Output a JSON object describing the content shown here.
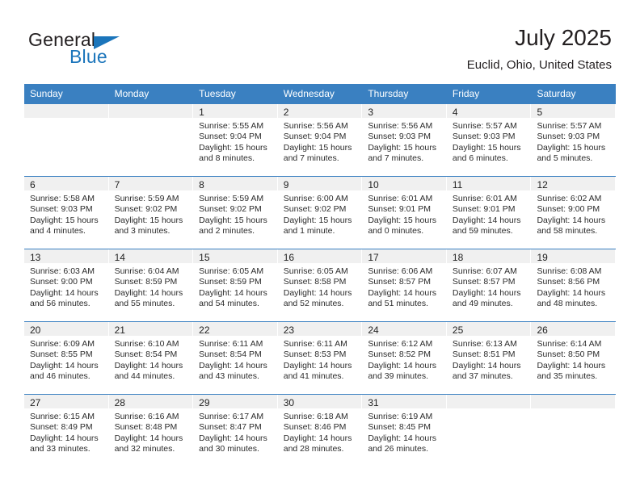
{
  "brand": {
    "name_part1": "General",
    "name_part2": "Blue",
    "triangle_icon": "triangle-icon",
    "accent_color": "#1b75bb"
  },
  "header": {
    "title": "July 2025",
    "location": "Euclid, Ohio, United States"
  },
  "calendar": {
    "header_bg": "#3a80c1",
    "day_band_bg": "#f0f0f0",
    "weekdays": [
      "Sunday",
      "Monday",
      "Tuesday",
      "Wednesday",
      "Thursday",
      "Friday",
      "Saturday"
    ],
    "weeks": [
      [
        {
          "blank": true
        },
        {
          "blank": true
        },
        {
          "day": "1",
          "sunrise": "Sunrise: 5:55 AM",
          "sunset": "Sunset: 9:04 PM",
          "daylight": "Daylight: 15 hours and 8 minutes."
        },
        {
          "day": "2",
          "sunrise": "Sunrise: 5:56 AM",
          "sunset": "Sunset: 9:04 PM",
          "daylight": "Daylight: 15 hours and 7 minutes."
        },
        {
          "day": "3",
          "sunrise": "Sunrise: 5:56 AM",
          "sunset": "Sunset: 9:03 PM",
          "daylight": "Daylight: 15 hours and 7 minutes."
        },
        {
          "day": "4",
          "sunrise": "Sunrise: 5:57 AM",
          "sunset": "Sunset: 9:03 PM",
          "daylight": "Daylight: 15 hours and 6 minutes."
        },
        {
          "day": "5",
          "sunrise": "Sunrise: 5:57 AM",
          "sunset": "Sunset: 9:03 PM",
          "daylight": "Daylight: 15 hours and 5 minutes."
        }
      ],
      [
        {
          "day": "6",
          "sunrise": "Sunrise: 5:58 AM",
          "sunset": "Sunset: 9:03 PM",
          "daylight": "Daylight: 15 hours and 4 minutes."
        },
        {
          "day": "7",
          "sunrise": "Sunrise: 5:59 AM",
          "sunset": "Sunset: 9:02 PM",
          "daylight": "Daylight: 15 hours and 3 minutes."
        },
        {
          "day": "8",
          "sunrise": "Sunrise: 5:59 AM",
          "sunset": "Sunset: 9:02 PM",
          "daylight": "Daylight: 15 hours and 2 minutes."
        },
        {
          "day": "9",
          "sunrise": "Sunrise: 6:00 AM",
          "sunset": "Sunset: 9:02 PM",
          "daylight": "Daylight: 15 hours and 1 minute."
        },
        {
          "day": "10",
          "sunrise": "Sunrise: 6:01 AM",
          "sunset": "Sunset: 9:01 PM",
          "daylight": "Daylight: 15 hours and 0 minutes."
        },
        {
          "day": "11",
          "sunrise": "Sunrise: 6:01 AM",
          "sunset": "Sunset: 9:01 PM",
          "daylight": "Daylight: 14 hours and 59 minutes."
        },
        {
          "day": "12",
          "sunrise": "Sunrise: 6:02 AM",
          "sunset": "Sunset: 9:00 PM",
          "daylight": "Daylight: 14 hours and 58 minutes."
        }
      ],
      [
        {
          "day": "13",
          "sunrise": "Sunrise: 6:03 AM",
          "sunset": "Sunset: 9:00 PM",
          "daylight": "Daylight: 14 hours and 56 minutes."
        },
        {
          "day": "14",
          "sunrise": "Sunrise: 6:04 AM",
          "sunset": "Sunset: 8:59 PM",
          "daylight": "Daylight: 14 hours and 55 minutes."
        },
        {
          "day": "15",
          "sunrise": "Sunrise: 6:05 AM",
          "sunset": "Sunset: 8:59 PM",
          "daylight": "Daylight: 14 hours and 54 minutes."
        },
        {
          "day": "16",
          "sunrise": "Sunrise: 6:05 AM",
          "sunset": "Sunset: 8:58 PM",
          "daylight": "Daylight: 14 hours and 52 minutes."
        },
        {
          "day": "17",
          "sunrise": "Sunrise: 6:06 AM",
          "sunset": "Sunset: 8:57 PM",
          "daylight": "Daylight: 14 hours and 51 minutes."
        },
        {
          "day": "18",
          "sunrise": "Sunrise: 6:07 AM",
          "sunset": "Sunset: 8:57 PM",
          "daylight": "Daylight: 14 hours and 49 minutes."
        },
        {
          "day": "19",
          "sunrise": "Sunrise: 6:08 AM",
          "sunset": "Sunset: 8:56 PM",
          "daylight": "Daylight: 14 hours and 48 minutes."
        }
      ],
      [
        {
          "day": "20",
          "sunrise": "Sunrise: 6:09 AM",
          "sunset": "Sunset: 8:55 PM",
          "daylight": "Daylight: 14 hours and 46 minutes."
        },
        {
          "day": "21",
          "sunrise": "Sunrise: 6:10 AM",
          "sunset": "Sunset: 8:54 PM",
          "daylight": "Daylight: 14 hours and 44 minutes."
        },
        {
          "day": "22",
          "sunrise": "Sunrise: 6:11 AM",
          "sunset": "Sunset: 8:54 PM",
          "daylight": "Daylight: 14 hours and 43 minutes."
        },
        {
          "day": "23",
          "sunrise": "Sunrise: 6:11 AM",
          "sunset": "Sunset: 8:53 PM",
          "daylight": "Daylight: 14 hours and 41 minutes."
        },
        {
          "day": "24",
          "sunrise": "Sunrise: 6:12 AM",
          "sunset": "Sunset: 8:52 PM",
          "daylight": "Daylight: 14 hours and 39 minutes."
        },
        {
          "day": "25",
          "sunrise": "Sunrise: 6:13 AM",
          "sunset": "Sunset: 8:51 PM",
          "daylight": "Daylight: 14 hours and 37 minutes."
        },
        {
          "day": "26",
          "sunrise": "Sunrise: 6:14 AM",
          "sunset": "Sunset: 8:50 PM",
          "daylight": "Daylight: 14 hours and 35 minutes."
        }
      ],
      [
        {
          "day": "27",
          "sunrise": "Sunrise: 6:15 AM",
          "sunset": "Sunset: 8:49 PM",
          "daylight": "Daylight: 14 hours and 33 minutes."
        },
        {
          "day": "28",
          "sunrise": "Sunrise: 6:16 AM",
          "sunset": "Sunset: 8:48 PM",
          "daylight": "Daylight: 14 hours and 32 minutes."
        },
        {
          "day": "29",
          "sunrise": "Sunrise: 6:17 AM",
          "sunset": "Sunset: 8:47 PM",
          "daylight": "Daylight: 14 hours and 30 minutes."
        },
        {
          "day": "30",
          "sunrise": "Sunrise: 6:18 AM",
          "sunset": "Sunset: 8:46 PM",
          "daylight": "Daylight: 14 hours and 28 minutes."
        },
        {
          "day": "31",
          "sunrise": "Sunrise: 6:19 AM",
          "sunset": "Sunset: 8:45 PM",
          "daylight": "Daylight: 14 hours and 26 minutes."
        },
        {
          "blank": true
        },
        {
          "blank": true
        }
      ]
    ]
  }
}
